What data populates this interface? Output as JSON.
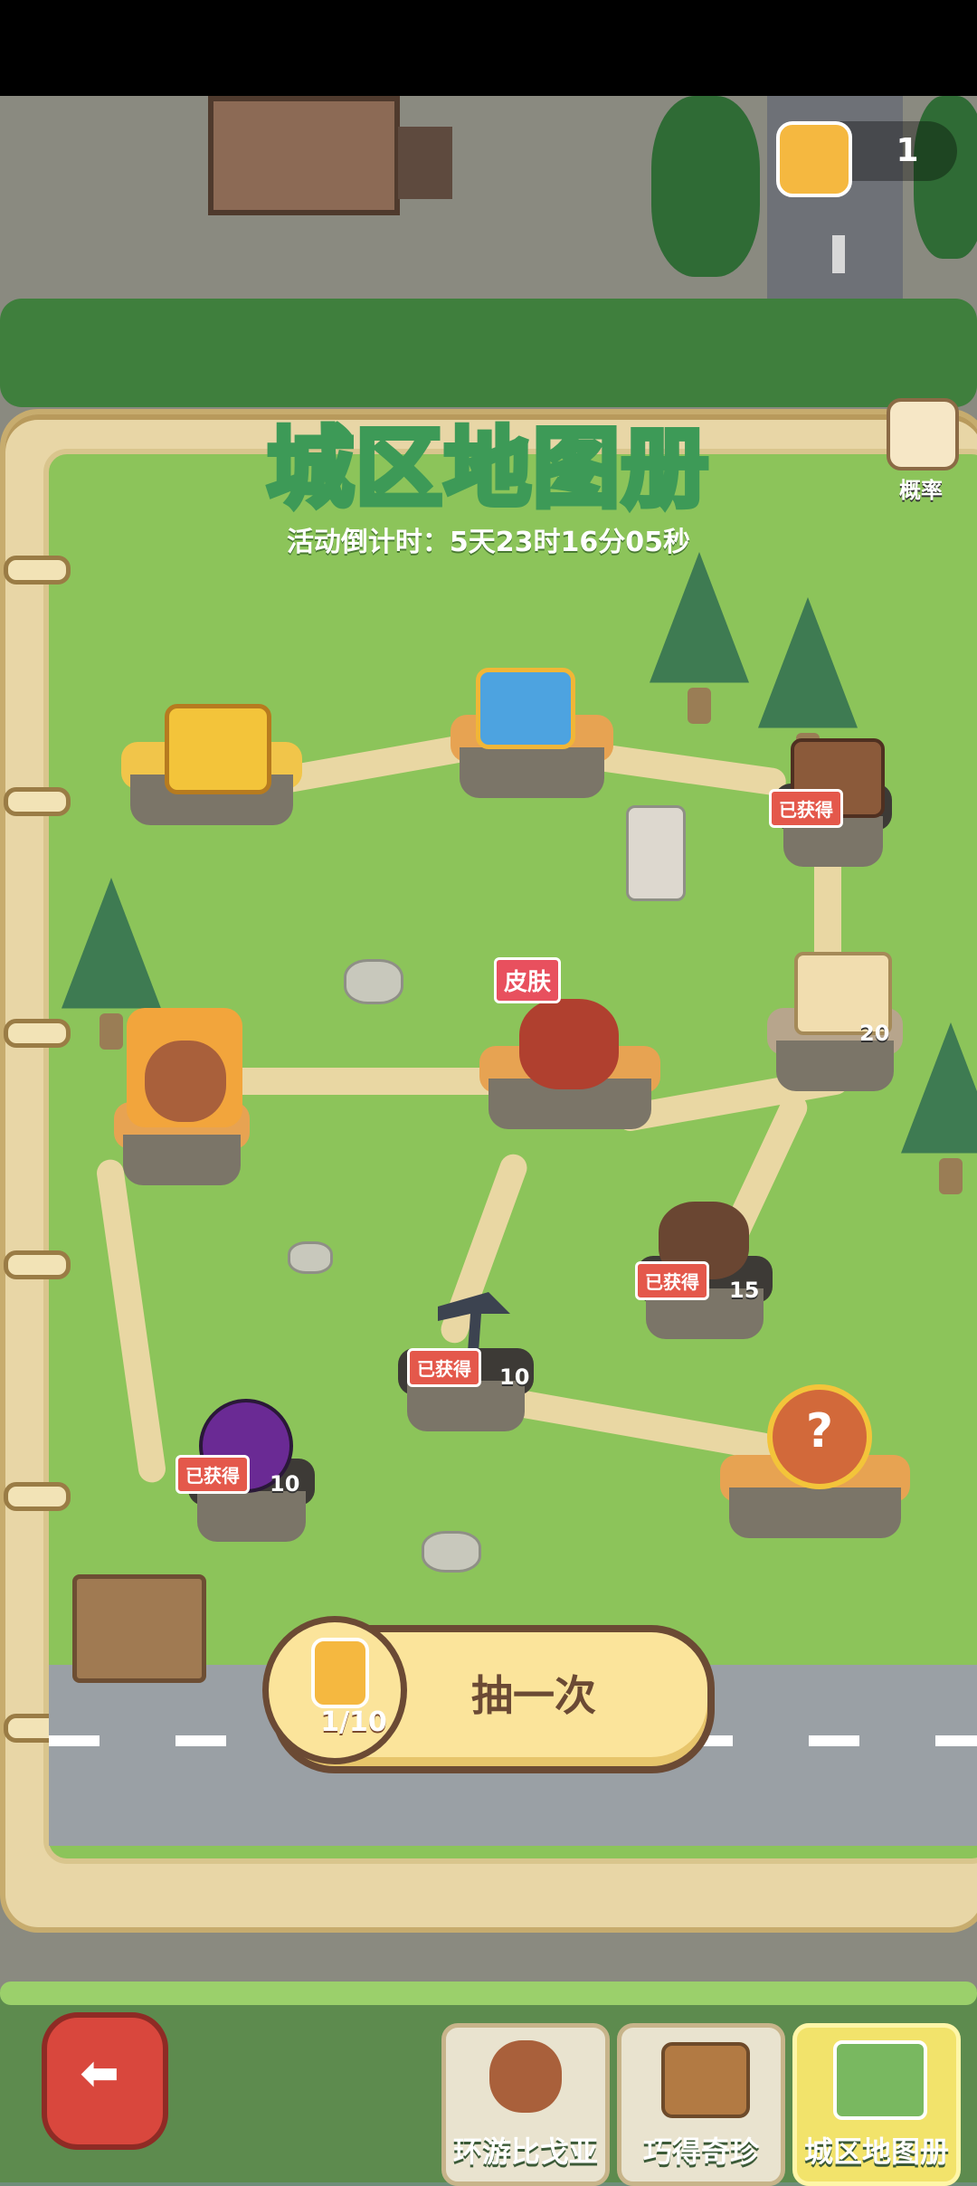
{
  "header": {
    "title": "城区地图册",
    "countdown": "活动倒计时：5天23时16分05秒"
  },
  "currency": {
    "icon": "honey-jar-icon",
    "count": "1"
  },
  "probability": {
    "icon": "document-icon",
    "label": "概率"
  },
  "map_nodes": [
    {
      "id": "gold-chest",
      "icon": "golden-chest-icon",
      "label": "",
      "count": ""
    },
    {
      "id": "blue-chest",
      "icon": "blue-chest-icon",
      "label": "",
      "count": ""
    },
    {
      "id": "wood-chest",
      "icon": "wooden-chest-icon",
      "label": "已获得",
      "count": ""
    },
    {
      "id": "bear-portrait",
      "icon": "bear-avatar-icon",
      "label": "",
      "count": ""
    },
    {
      "id": "skin",
      "icon": "armored-bear-icon",
      "label": "皮肤",
      "count": ""
    },
    {
      "id": "scroll",
      "icon": "scroll-icon",
      "label": "",
      "count": "20"
    },
    {
      "id": "cannon",
      "icon": "cannon-icon",
      "label": "已获得",
      "count": "15"
    },
    {
      "id": "pickaxe",
      "icon": "pickaxe-icon",
      "label": "已获得",
      "count": "10"
    },
    {
      "id": "orb",
      "icon": "purple-orb-icon",
      "label": "已获得",
      "count": "10"
    },
    {
      "id": "mystery",
      "icon": "question-mark-icon",
      "label": "",
      "count": ""
    }
  ],
  "draw": {
    "label": "抽一次",
    "cost": "1/10",
    "icon": "honey-jar-icon"
  },
  "bottom_tabs": [
    {
      "label": "环游比戈亚",
      "icon": "bear-tour-icon",
      "active": false
    },
    {
      "label": "巧得奇珍",
      "icon": "treasure-suitcase-icon",
      "active": false
    },
    {
      "label": "城区地图册",
      "icon": "map-flag-icon",
      "active": true
    }
  ],
  "back": {
    "icon": "back-arrow-icon"
  },
  "colors": {
    "grass": "#8cc45a",
    "path": "#e9d7a3",
    "flag": "#e4584b",
    "title_stroke": "#3d9a57",
    "draw_button": "#fbe49b"
  }
}
